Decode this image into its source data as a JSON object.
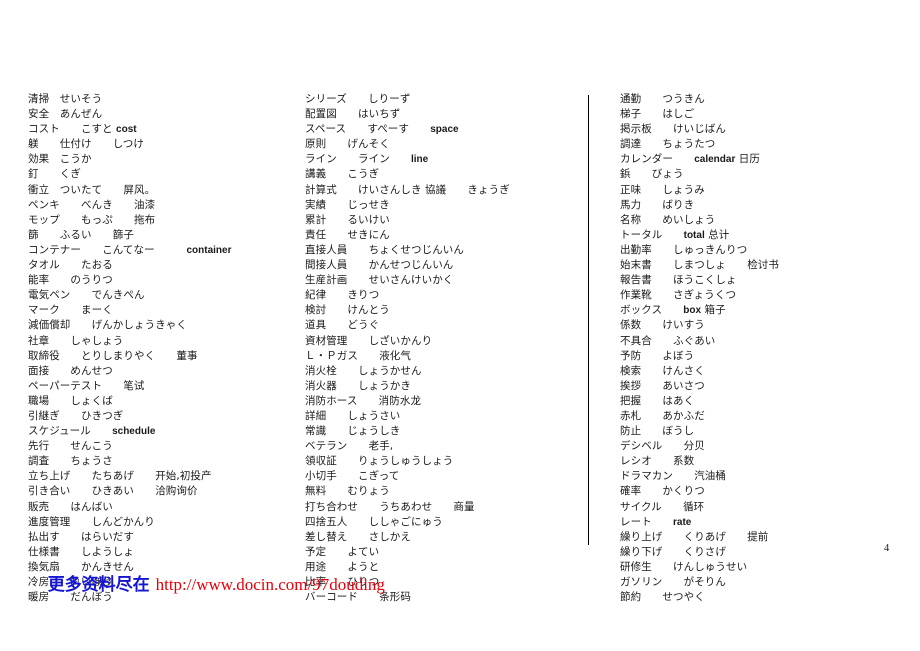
{
  "document": {
    "page_number": "4",
    "columns": [
      {
        "id": "column-1",
        "entries": [
          {
            "text": "清掃　せいそう"
          },
          {
            "text": "安全　あんぜん"
          },
          {
            "text": "コスト　　こすと ",
            "en": "cost"
          },
          {
            "text": "躾　　仕付け　　しつけ"
          },
          {
            "text": "効果　こうか"
          },
          {
            "text": "釘　　くぎ"
          },
          {
            "text": "衝立　ついたて　　屏风。"
          },
          {
            "text": "ペンキ　　べんき　　油漆"
          },
          {
            "text": "モップ　　もっぷ　　拖布"
          },
          {
            "text": "篩　　ふるい　　篩子"
          },
          {
            "text": "コンテナー　　こんてなー　　　",
            "en": "container"
          },
          {
            "text": "タオル　　たおる"
          },
          {
            "text": "能率　　のうりつ"
          },
          {
            "text": "電気ペン　　でんきぺん"
          },
          {
            "text": "マーク　　まーく"
          },
          {
            "text": "減価償却　　げんかしょうきゃく"
          },
          {
            "text": "社章　　しゃしょう"
          },
          {
            "text": "取締役　　とりしまりやく　　董事"
          },
          {
            "text": "面接　　めんせつ"
          },
          {
            "text": "ペーパーテスト　　笔试"
          },
          {
            "text": "職場　　しょくば"
          },
          {
            "text": "引継ぎ　　ひきつぎ"
          },
          {
            "text": "スケジュール　　",
            "en": "schedule"
          },
          {
            "text": "先行　　せんこう"
          },
          {
            "text": "調査　　ちょうさ"
          },
          {
            "text": "立ち上げ　　たちあげ　　开始,初投产"
          },
          {
            "text": "引き合い　　ひきあい　　洽购询价"
          },
          {
            "text": "販売　　はんばい"
          },
          {
            "text": "進度管理　　しんどかんり"
          },
          {
            "text": "払出す　　はらいだす"
          },
          {
            "text": "仕様書　　しようしょ"
          },
          {
            "text": "換気扇　　かんきせん"
          },
          {
            "text": "冷房　　れいぼう"
          },
          {
            "text": "暖房　　だんぼう"
          }
        ]
      },
      {
        "id": "column-2",
        "entries": [
          {
            "text": "シリーズ　　しりーず"
          },
          {
            "text": "配置図　　はいちず"
          },
          {
            "text": "スペース　　すぺーす　　",
            "en": "space"
          },
          {
            "text": "原則　　げんそく"
          },
          {
            "text": "ライン　　ライン　　",
            "en": "line"
          },
          {
            "text": "講義　　こうぎ"
          },
          {
            "text": "計算式　　けいさんしき 協議　　きょうぎ"
          },
          {
            "text": "実績　　じっせき"
          },
          {
            "text": "累計　　るいけい"
          },
          {
            "text": "責任　　せきにん"
          },
          {
            "text": "直接人員　　ちょくせつじんいん"
          },
          {
            "text": "間接人員　　かんせつじんいん"
          },
          {
            "text": "生産計画　　せいさんけいかく"
          },
          {
            "text": "紀律　　きりつ"
          },
          {
            "text": "検討　　けんとう"
          },
          {
            "text": "道具　　どうぐ"
          },
          {
            "text": "資材管理　　しざいかんり"
          },
          {
            "text": "Ｌ・Ｐガス　　液化气"
          },
          {
            "text": "消火栓　　しょうかせん"
          },
          {
            "text": "消火器　　しょうかき"
          },
          {
            "text": "消防ホース　　消防水龙"
          },
          {
            "text": "詳細　　しょうさい"
          },
          {
            "text": "常識　　じょうしき"
          },
          {
            "text": "ベテラン　　老手,"
          },
          {
            "text": "領収証　　りょうしゅうしょう"
          },
          {
            "text": "小切手　　こぎって"
          },
          {
            "text": "無料　　むりょう"
          },
          {
            "text": "打ち合わせ　　うちあわせ　　商量"
          },
          {
            "text": "四捨五人　　ししゃごにゅう"
          },
          {
            "text": "差し替え　　さしかえ"
          },
          {
            "text": "予定　　よてい"
          },
          {
            "text": "用途　　ようと"
          },
          {
            "text": "比率　　ひりつ"
          },
          {
            "text": "バーコード　　条形码"
          }
        ]
      },
      {
        "id": "column-3",
        "entries": [
          {
            "text": "通勤　　つうきん"
          },
          {
            "text": "梯子　　はしご"
          },
          {
            "text": "掲示板　　けいじばん"
          },
          {
            "text": "調達　　ちょうたつ"
          },
          {
            "text": "カレンダー　　",
            "en": "calendar",
            "text2": " 日历"
          },
          {
            "text": "鋲　　びょう"
          },
          {
            "text": "正味　　しょうみ"
          },
          {
            "text": "馬力　　ばりき"
          },
          {
            "text": "名称　　めいしょう"
          },
          {
            "text": "トータル　　",
            "en": "total",
            "text2": " 总计"
          },
          {
            "text": "出勤率　　しゅっきんりつ"
          },
          {
            "text": "始末書　　しまつしょ　　检讨书"
          },
          {
            "text": "報告書　　ほうこくしょ"
          },
          {
            "text": "作業靴　　さぎょうくつ"
          },
          {
            "text": "ボックス　　",
            "en": "box",
            "text2": " 箱子"
          },
          {
            "text": "係数　　けいすう"
          },
          {
            "text": "不具合　　ふぐあい"
          },
          {
            "text": "予防　　よぼう"
          },
          {
            "text": "検索　　けんさく"
          },
          {
            "text": "挨拶　　あいさつ"
          },
          {
            "text": "把握　　はあく"
          },
          {
            "text": "赤札　　あかふだ"
          },
          {
            "text": "防止　　ぼうし"
          },
          {
            "text": "デシベル　　分贝"
          },
          {
            "text": "レシオ　　系数"
          },
          {
            "text": "ドラマカン　　汽油桶"
          },
          {
            "text": "確率　　かくりつ"
          },
          {
            "text": "サイクル　　循环"
          },
          {
            "text": "レート　　",
            "en": "rate"
          },
          {
            "text": "繰り上げ　　くりあげ　　提前"
          },
          {
            "text": "繰り下げ　　くりさげ"
          },
          {
            "text": "研修生　　けんしゅうせい"
          },
          {
            "text": "ガソリン　　がそりん"
          },
          {
            "text": "節約　　せつやく"
          }
        ]
      }
    ],
    "watermark": {
      "cn_text": "更多资料尽在 ",
      "url": "http://www.docin.com/97douding",
      "cn_color": "#1414d2",
      "url_color": "#e8000a"
    }
  }
}
